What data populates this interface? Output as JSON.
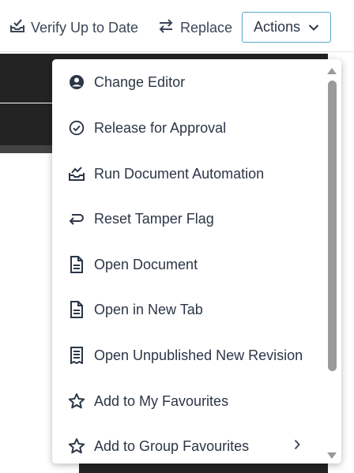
{
  "toolbar": {
    "verify_label": "Verify Up to Date",
    "replace_label": "Replace",
    "actions_label": "Actions"
  },
  "menu": {
    "items": [
      {
        "label": "Change Editor",
        "icon": "user-circle-icon"
      },
      {
        "label": "Release for Approval",
        "icon": "check-circle-icon"
      },
      {
        "label": "Run Document Automation",
        "icon": "automation-tray-icon"
      },
      {
        "label": "Reset Tamper Flag",
        "icon": "return-arrow-icon"
      },
      {
        "label": "Open Document",
        "icon": "document-icon"
      },
      {
        "label": "Open in New Tab",
        "icon": "document-icon"
      },
      {
        "label": "Open Unpublished New Revision",
        "icon": "receipt-document-icon"
      },
      {
        "label": "Add to My Favourites",
        "icon": "star-icon"
      },
      {
        "label": "Add to Group Favourites",
        "icon": "star-icon",
        "submenu_icon": "chevron-right-icon"
      }
    ]
  },
  "colors": {
    "accent_border": "#58a8c8",
    "text": "#2b3646",
    "icon": "#2b3646",
    "dark_background": "#232323",
    "scrollbar": "#9a9a9a"
  }
}
